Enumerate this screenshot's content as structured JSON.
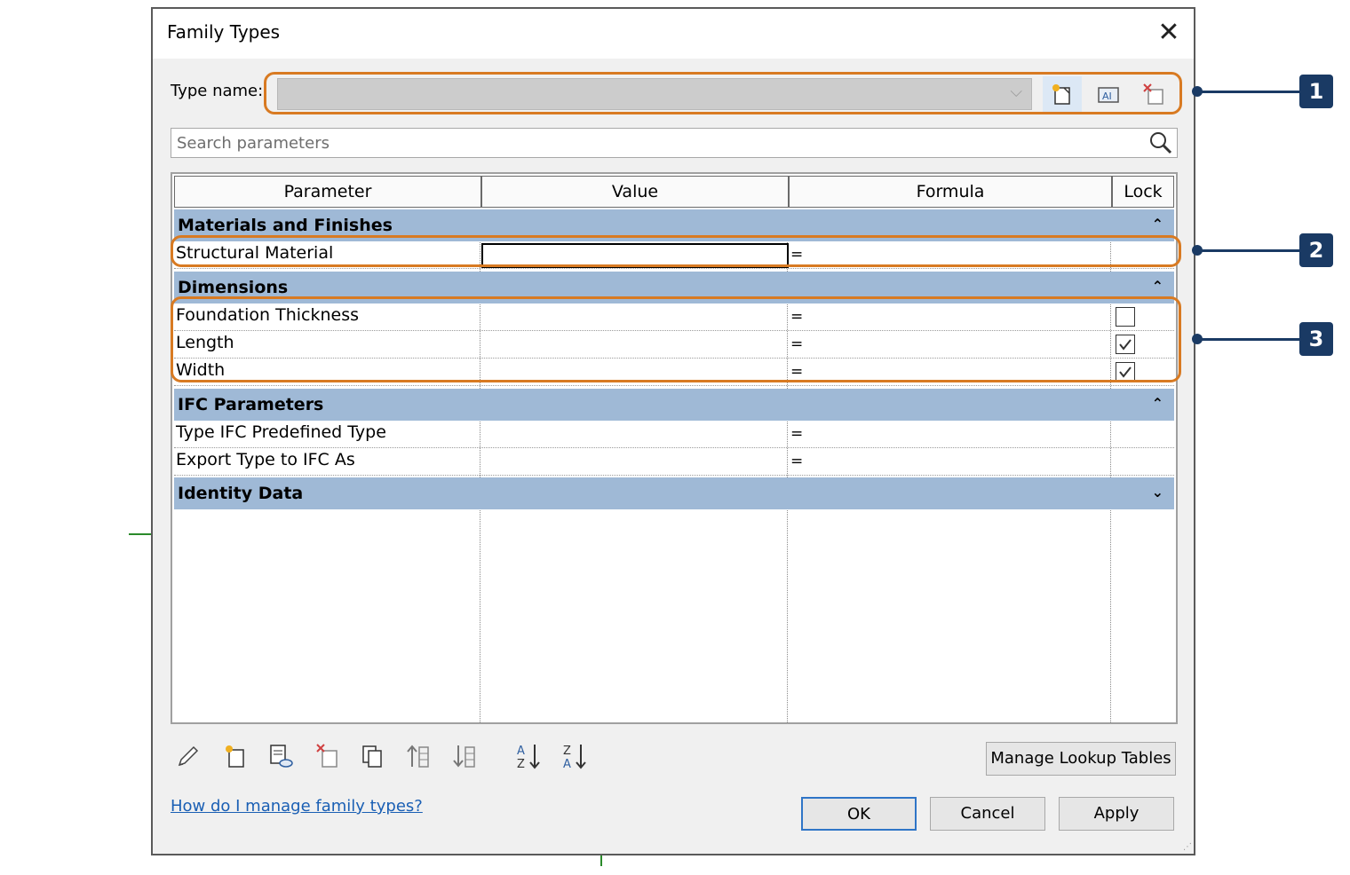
{
  "dialog": {
    "title": "Family Types",
    "type_name_label": "Type name:",
    "type_name_value": "",
    "search_placeholder": "Search parameters"
  },
  "grid": {
    "columns": [
      "Parameter",
      "Value",
      "Formula",
      "Lock"
    ],
    "groups": [
      {
        "name": "Materials and Finishes",
        "expanded": true,
        "rows": [
          {
            "parameter": "Structural Material",
            "value": "",
            "formula": "=",
            "lock": null
          }
        ]
      },
      {
        "name": "Dimensions",
        "expanded": true,
        "rows": [
          {
            "parameter": "Foundation Thickness",
            "value": "",
            "formula": "=",
            "lock": false
          },
          {
            "parameter": "Length",
            "value": "",
            "formula": "=",
            "lock": true
          },
          {
            "parameter": "Width",
            "value": "",
            "formula": "=",
            "lock": true
          }
        ]
      },
      {
        "name": "IFC Parameters",
        "expanded": true,
        "rows": [
          {
            "parameter": "Type IFC Predefined Type",
            "value": "",
            "formula": "=",
            "lock": null
          },
          {
            "parameter": "Export Type to IFC As",
            "value": "",
            "formula": "=",
            "lock": null
          }
        ]
      },
      {
        "name": "Identity Data",
        "expanded": false,
        "rows": []
      }
    ]
  },
  "buttons": {
    "manage_lookup": "Manage Lookup Tables",
    "help_link": "How do I manage family types?",
    "ok": "OK",
    "cancel": "Cancel",
    "apply": "Apply"
  },
  "callouts": [
    "1",
    "2",
    "3"
  ],
  "icons": {
    "type_toolbar": [
      "new-type-icon",
      "rename-type-icon",
      "delete-type-icon"
    ],
    "bottom_toolbar": [
      "edit-parameter-icon",
      "new-parameter-icon",
      "parameter-from-shared-icon",
      "delete-parameter-icon",
      "copy-icon",
      "move-up-icon",
      "move-down-icon",
      "sort-ascending-icon",
      "sort-descending-icon"
    ]
  },
  "colors": {
    "callout_border": "#d87a22",
    "badge": "#1a3a64",
    "group_header": "#9fb9d6",
    "link": "#1a5fb4"
  }
}
